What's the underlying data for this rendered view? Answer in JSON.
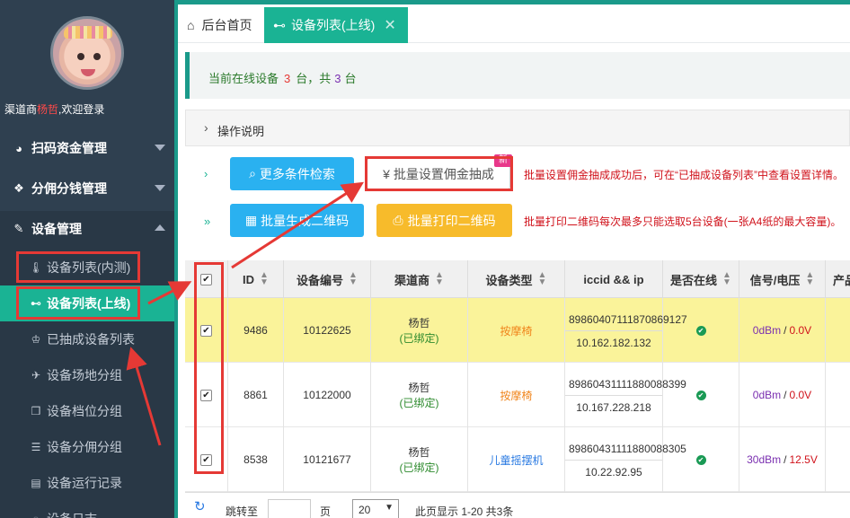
{
  "sidebar": {
    "welcome_prefix": "渠道商",
    "welcome_name": "杨哲",
    "welcome_suffix": ",欢迎登录",
    "menus": [
      {
        "label": "扫码资金管理",
        "icon": "pie-chart-icon"
      },
      {
        "label": "分佣分钱管理",
        "icon": "gift-icon"
      },
      {
        "label": "设备管理",
        "icon": "wrench-icon"
      }
    ],
    "submenu": [
      {
        "label": "设备列表(内测)",
        "icon": "thermometer-icon"
      },
      {
        "label": "设备列表(上线)",
        "icon": "plug-icon"
      },
      {
        "label": "已抽成设备列表",
        "icon": "trophy-icon"
      },
      {
        "label": "设备场地分组",
        "icon": "plane-icon"
      },
      {
        "label": "设备档位分组",
        "icon": "cubes-icon"
      },
      {
        "label": "设备分佣分组",
        "icon": "database-icon"
      },
      {
        "label": "设备运行记录",
        "icon": "book-icon"
      },
      {
        "label": "设备日志",
        "icon": "circle-icon"
      }
    ]
  },
  "tabs": [
    {
      "label": "后台首页",
      "icon": "home-icon"
    },
    {
      "label": "设备列表(上线)",
      "icon": "plug-icon",
      "close": "✕"
    }
  ],
  "alert": {
    "prefix": "当前在线设备",
    "online": "3",
    "mid": "台，共",
    "total": "3",
    "suffix": "台"
  },
  "help": {
    "chevron": "›",
    "label": "操作说明"
  },
  "toolbar": {
    "arrow1": "›",
    "arrow2": "»",
    "search_label": "更多条件检索",
    "commission_label": "¥ 批量设置佣金抽成",
    "new_badge": "新",
    "commission_note": "批量设置佣金抽成成功后，可在“已抽成设备列表”中查看设置详情。",
    "qrcode_label": "批量生成二维码",
    "print_label": "批量打印二维码",
    "print_note": "批量打印二维码每次最多只能选取5台设备(一张A4纸的最大容量)。"
  },
  "table": {
    "headers": [
      "ID",
      "设备编号",
      "渠道商",
      "设备类型",
      "iccid && ip",
      "是否在线",
      "信号/电压",
      "产品"
    ],
    "rows": [
      {
        "checked": true,
        "id": "9486",
        "code": "10122625",
        "dealer": "杨哲",
        "bind": "(已绑定)",
        "type": "按摩椅",
        "iccid": "89860407111870869127",
        "ip": "10.162.182.132",
        "signal": "0dBm",
        "volt": "0.0V"
      },
      {
        "checked": true,
        "id": "8861",
        "code": "10122000",
        "dealer": "杨哲",
        "bind": "(已绑定)",
        "type": "按摩椅",
        "iccid": "89860431111880088399",
        "ip": "10.167.228.218",
        "signal": "0dBm",
        "volt": "0.0V"
      },
      {
        "checked": true,
        "id": "8538",
        "code": "10121677",
        "dealer": "杨哲",
        "bind": "(已绑定)",
        "type": "儿童摇摆机",
        "iccid": "89860431111880088305",
        "ip": "10.22.92.95",
        "signal": "30dBm",
        "volt": "12.5V"
      }
    ]
  },
  "footer": {
    "jump_label": "跳转至",
    "page_unit": "页",
    "page_size": "20",
    "summary": "此页显示 1-20 共3条"
  },
  "colors": {
    "accent": "#1ab394",
    "sidebar": "#2f4050",
    "highlight_row": "#faf39a",
    "annotation": "#e53935"
  }
}
